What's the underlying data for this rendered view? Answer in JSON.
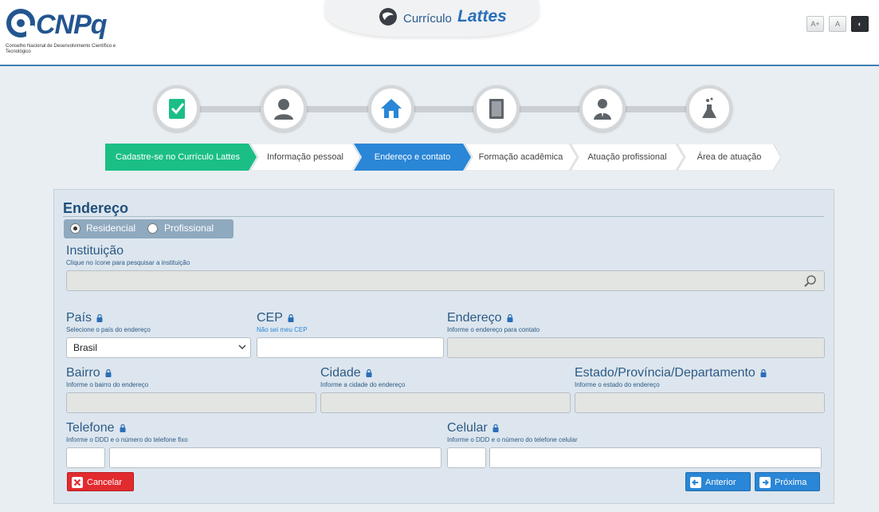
{
  "header": {
    "logo_text": "CNPq",
    "logo_subtitle": "Conselho Nacional de Desenvolvimento Científico e Tecnológico",
    "brand_prefix": "Currículo",
    "brand_name": "Lattes",
    "font_increase": "A+",
    "font_normal": "A",
    "contrast": "◐"
  },
  "steps": [
    {
      "label": "Cadastre-se no Currículo Lattes",
      "icon": "form-check-icon",
      "state": "done"
    },
    {
      "label": "Informação pessoal",
      "icon": "person-icon",
      "state": "todo"
    },
    {
      "label": "Endereço e contato",
      "icon": "house-icon",
      "state": "active"
    },
    {
      "label": "Formação acadêmica",
      "icon": "book-icon",
      "state": "todo"
    },
    {
      "label": "Atuação profissional",
      "icon": "professional-icon",
      "state": "todo"
    },
    {
      "label": "Área de atuação",
      "icon": "flask-icon",
      "state": "todo"
    }
  ],
  "colors": {
    "done": "#1bbf86",
    "active": "#2a86d6",
    "todo": "#ffffff"
  },
  "form": {
    "section_title": "Endereço",
    "radio": {
      "residencial": "Residencial",
      "profissional": "Profissional",
      "selected": "Residencial"
    },
    "instituicao": {
      "label": "Instituição",
      "hint": "Clique no ícone para pesquisar a instituição",
      "value": ""
    },
    "pais": {
      "label": "País",
      "hint": "Selecione o país do endereço",
      "value": "Brasil"
    },
    "cep": {
      "label": "CEP",
      "hint": "Não sei meu CEP",
      "value": ""
    },
    "endereco": {
      "label": "Endereço",
      "hint": "Informe o endereço para contato",
      "value": ""
    },
    "bairro": {
      "label": "Bairro",
      "hint": "Informe o bairro do endereço",
      "value": ""
    },
    "cidade": {
      "label": "Cidade",
      "hint": "Informe a cidade do endereço",
      "value": ""
    },
    "estado": {
      "label": "Estado/Província/Departamento",
      "hint": "Informe o estado do endereço",
      "value": ""
    },
    "telefone": {
      "label": "Telefone",
      "hint": "Informe o DDD e o número do telefone fixo",
      "ddd": "",
      "numero": ""
    },
    "celular": {
      "label": "Celular",
      "hint": "Informe o DDD e o número do telefone celular",
      "ddd": "",
      "numero": ""
    }
  },
  "buttons": {
    "cancel": "Cancelar",
    "previous": "Anterior",
    "next": "Próxima"
  }
}
